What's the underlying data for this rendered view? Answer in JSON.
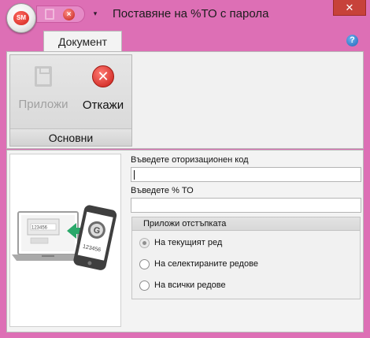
{
  "window": {
    "title": "Поставяне на %ТО с парола",
    "logo_text": "SM",
    "close_glyph": "✕"
  },
  "qat": {
    "save_icon": "save-icon",
    "cancel_icon": "cancel-icon",
    "dropdown_glyph": "▾"
  },
  "ribbon": {
    "tab_label": "Документ",
    "help_glyph": "?",
    "group_label": "Основни",
    "apply_label": "Приложи",
    "cancel_label": "Откажи"
  },
  "form": {
    "auth_code_label": "Въведете оторизационен код",
    "auth_code_value": "",
    "percent_label": "Въведете % ТО",
    "percent_value": ""
  },
  "discount_group": {
    "title": "Приложи отстъпката",
    "options": [
      {
        "label": "На текущият ред",
        "selected": true
      },
      {
        "label": "На селектираните редове",
        "selected": false
      },
      {
        "label": "На всички редове",
        "selected": false
      }
    ]
  },
  "illustration": {
    "screen_code": "123456",
    "phone_code": "123456",
    "phone_logo": "G"
  },
  "colors": {
    "window_frame": "#dd6fb5",
    "accent_red": "#c81b15",
    "arrow_green": "#2aa86a"
  }
}
